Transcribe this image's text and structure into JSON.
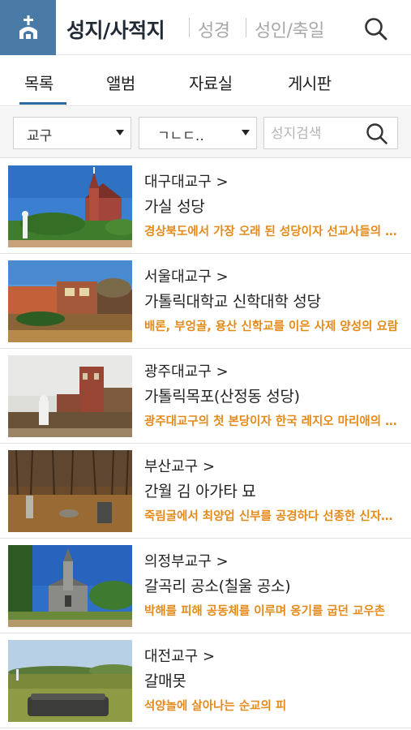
{
  "header": {
    "title": "성지/사적지",
    "nav": [
      "성경",
      "성인/축일"
    ],
    "logo_icon": "church-cross-icon",
    "search_icon": "search-icon"
  },
  "tabs": [
    "목록",
    "앨범",
    "자료실",
    "게시판"
  ],
  "active_tab": "목록",
  "filters": {
    "diocese_select": "교구",
    "initial_select": "ㄱㄴㄷ..",
    "search_placeholder": "성지검색"
  },
  "sites": [
    {
      "diocese": "대구대교구 >",
      "name": "가실 성당",
      "desc": "경상북도에서 가장 오래 된 성당이자 선교사들의 활동 중심지"
    },
    {
      "diocese": "서울대교구 >",
      "name": "가톨릭대학교 신학대학 성당",
      "desc": "배론, 부엉골, 용산 신학교를 이은 사제 양성의 요람"
    },
    {
      "diocese": "광주대교구 >",
      "name": "가톨릭목포(산정동 성당)",
      "desc": "광주대교구의 첫 본당이자 한국 레지오 마리애의 발상지"
    },
    {
      "diocese": "부산교구 >",
      "name": "간월 김 아가타 묘",
      "desc": "죽림굴에서 최양업 신부를 공경하다 선종한 신자의 묘"
    },
    {
      "diocese": "의정부교구 >",
      "name": "갈곡리 공소(칠울 공소)",
      "desc": "박해를 피해 공동체를 이루며 옹기를 굽던 교우촌"
    },
    {
      "diocese": "대전교구 >",
      "name": "갈매못",
      "desc": "석양놀에 살아나는 순교의 피"
    }
  ],
  "colors": {
    "brand": "#4a7ba7",
    "accent_desc": "#e48a1a",
    "tab_underline": "#2f6a9e"
  }
}
